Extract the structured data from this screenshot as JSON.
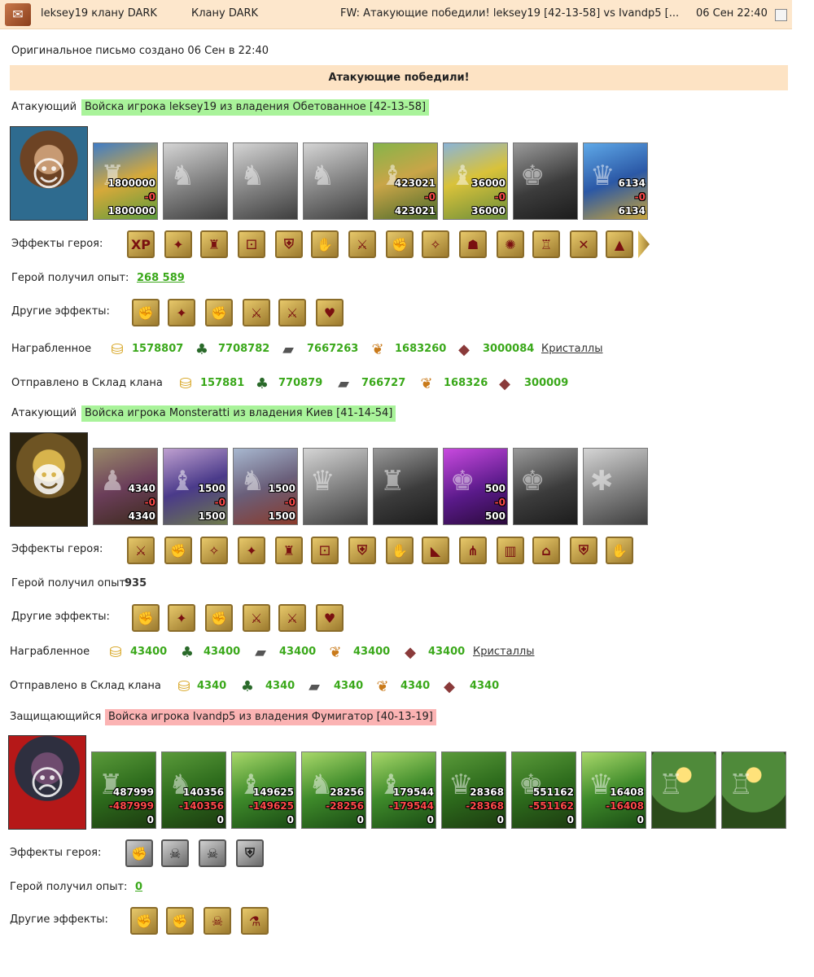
{
  "header": {
    "from": "leksey19 клану DARK",
    "to": "Клану DARK",
    "subject": "FW: Атакующие победили! leksey19 [42-13-58] vs Ivandp5 [...",
    "date": "06 Сен 22:40"
  },
  "original_created": "Оригинальное письмо создано 06 Сен в 22:40",
  "result": "Атакующие победили!",
  "labels": {
    "attacker": "Атакующий",
    "defender": "Защищающийся",
    "hero_effects": "Эффекты героя:",
    "hero_exp": "Герой получил опыт:",
    "other_effects": "Другие эффекты:",
    "looted": "Награбленное",
    "sent_to_clan": "Отправлено в Склад клана",
    "crystals": "Кристаллы"
  },
  "armies": [
    {
      "army_label": "Войска игрока leksey19 из владения Обетованное [42-13-58]",
      "units": [
        {
          "a": "1800000",
          "b": "-0",
          "c": "1800000"
        },
        {
          "a": "",
          "b": "",
          "c": ""
        },
        {
          "a": "",
          "b": "",
          "c": ""
        },
        {
          "a": "",
          "b": "",
          "c": ""
        },
        {
          "a": "423021",
          "b": "-0",
          "c": "423021"
        },
        {
          "a": "36000",
          "b": "-0",
          "c": "36000"
        },
        {
          "a": "",
          "b": "",
          "c": ""
        },
        {
          "a": "6134",
          "b": "-0",
          "c": "6134"
        }
      ],
      "exp": "268 589",
      "looted": [
        "1578807",
        "7708782",
        "7667263",
        "1683260",
        "3000084"
      ],
      "sent": [
        "157881",
        "770879",
        "766727",
        "168326",
        "300009"
      ]
    },
    {
      "army_label": "Войска игрока Monsteratti из владения Киев [41-14-54]",
      "units": [
        {
          "a": "4340",
          "b": "-0",
          "c": "4340"
        },
        {
          "a": "1500",
          "b": "-0",
          "c": "1500"
        },
        {
          "a": "1500",
          "b": "-0",
          "c": "1500"
        },
        {
          "a": "",
          "b": "",
          "c": ""
        },
        {
          "a": "",
          "b": "",
          "c": ""
        },
        {
          "a": "500",
          "b": "-0",
          "c": "500"
        },
        {
          "a": "",
          "b": "",
          "c": ""
        },
        {
          "a": "",
          "b": "",
          "c": ""
        }
      ],
      "exp": "935",
      "looted": [
        "43400",
        "43400",
        "43400",
        "43400",
        "43400"
      ],
      "sent": [
        "4340",
        "4340",
        "4340",
        "4340",
        "4340"
      ]
    },
    {
      "army_label": "Войска игрока Ivandp5 из владения Фумигатор [40-13-19]",
      "units": [
        {
          "a": "487999",
          "b": "-487999",
          "c": "0"
        },
        {
          "a": "140356",
          "b": "-140356",
          "c": "0"
        },
        {
          "a": "149625",
          "b": "-149625",
          "c": "0"
        },
        {
          "a": "28256",
          "b": "-28256",
          "c": "0"
        },
        {
          "a": "179544",
          "b": "-179544",
          "c": "0"
        },
        {
          "a": "28368",
          "b": "-28368",
          "c": "0"
        },
        {
          "a": "551162",
          "b": "-551162",
          "c": "0"
        },
        {
          "a": "16408",
          "b": "-16408",
          "c": "0"
        },
        {
          "a": "",
          "b": "",
          "c": ""
        },
        {
          "a": "",
          "b": "",
          "c": ""
        }
      ],
      "exp": "0"
    }
  ],
  "icons": {
    "header": "letter-icon",
    "effects_1": [
      "xp-icon",
      "xp-scroll-icon",
      "castle-icon",
      "fist-dice-icon",
      "shield-icon",
      "hand-shield-icon",
      "sword-icon",
      "hand-sword-icon",
      "magic-hand-icon",
      "hood-icon",
      "web-icon",
      "armor-icon",
      "broken-sword-icon",
      "tent-icon"
    ],
    "resources": [
      "gold-icon",
      "wood-icon",
      "ore-icon",
      "grain-icon",
      "crystal-icon"
    ]
  }
}
